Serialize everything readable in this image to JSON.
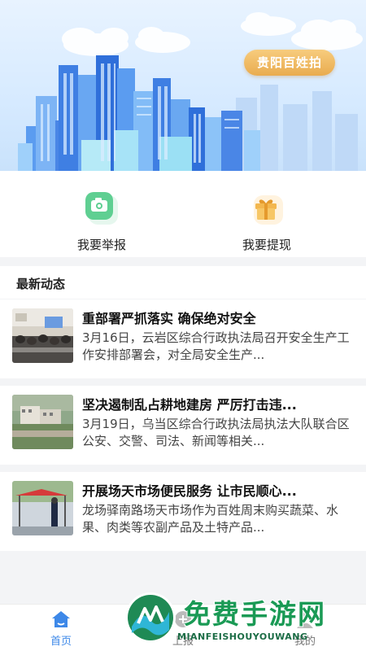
{
  "hero": {
    "tag": "贵阳百姓拍"
  },
  "actions": [
    {
      "label": "我要举报",
      "icon": "camera-icon"
    },
    {
      "label": "我要提现",
      "icon": "gift-icon"
    }
  ],
  "news_section": {
    "title": "最新动态"
  },
  "news": [
    {
      "title": "重部署严抓落实  确保绝对安全",
      "desc": "3月16日，云岩区综合行政执法局召开安全生产工作安排部署会，对全局安全生产..."
    },
    {
      "title": "坚决遏制乱占耕地建房 严厉打击违...",
      "desc": "3月19日，乌当区综合行政执法局执法大队联合区公安、交警、司法、新闻等相关..."
    },
    {
      "title": "开展场天市场便民服务  让市民顺心...",
      "desc": "龙场驿南路场天市场作为百姓周末购买蔬菜、水果、肉类等农副产品及土特产品..."
    }
  ],
  "tabbar": {
    "home": "首页",
    "upload": "上报",
    "mine": "我的"
  },
  "watermark": {
    "big": "免费手游网",
    "small": "MIANFEISHOUYOUWANG"
  },
  "colors": {
    "accent": "#3d88e8",
    "tag": "#e9ac4f",
    "watermark": "#1a9a55"
  }
}
